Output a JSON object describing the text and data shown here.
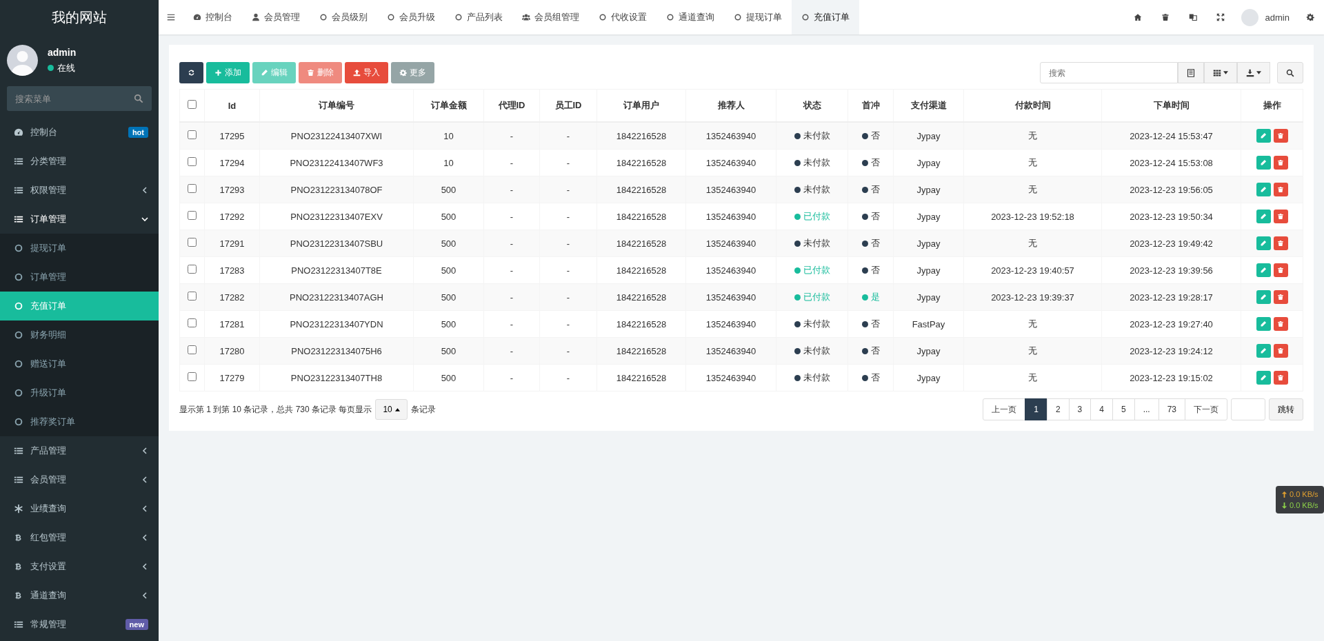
{
  "sidebar": {
    "title": "我的网站",
    "user": {
      "name": "admin",
      "status": "在线"
    },
    "search": {
      "placeholder": "搜索菜单"
    },
    "items": [
      {
        "label": "控制台",
        "kind": "dashboard",
        "badge": "hot",
        "color": "#0073b7"
      },
      {
        "label": "分类管理",
        "kind": "list"
      },
      {
        "label": "权限管理",
        "kind": "list",
        "expanded": false
      },
      {
        "label": "订单管理",
        "kind": "list",
        "expanded": true,
        "children": [
          {
            "label": "提现订单",
            "selected": false
          },
          {
            "label": "订单管理",
            "selected": false
          },
          {
            "label": "充值订单",
            "selected": true
          },
          {
            "label": "财务明细",
            "selected": false
          },
          {
            "label": "赠送订单",
            "selected": false
          },
          {
            "label": "升级订单",
            "selected": false
          },
          {
            "label": "推荐奖订单",
            "selected": false
          }
        ]
      },
      {
        "label": "产品管理",
        "kind": "list",
        "expanded": false
      },
      {
        "label": "会员管理",
        "kind": "list",
        "expanded": false
      },
      {
        "label": "业绩查询",
        "kind": "asterisk",
        "expanded": false
      },
      {
        "label": "红包管理",
        "kind": "bitcoin",
        "expanded": false
      },
      {
        "label": "支付设置",
        "kind": "bitcoin",
        "expanded": false
      },
      {
        "label": "通道查询",
        "kind": "bitcoin",
        "expanded": false
      },
      {
        "label": "常规管理",
        "kind": "list",
        "badge": "new",
        "color": "#605ca8"
      }
    ]
  },
  "topbar": {
    "tabs": [
      {
        "label": "控制台",
        "kind": "dashboard",
        "selected": false
      },
      {
        "label": "会员管理",
        "kind": "user",
        "selected": false
      },
      {
        "label": "会员级别",
        "kind": "circle",
        "selected": false
      },
      {
        "label": "会员升级",
        "kind": "circle",
        "selected": false
      },
      {
        "label": "产品列表",
        "kind": "circle",
        "selected": false
      },
      {
        "label": "会员组管理",
        "kind": "users",
        "selected": false
      },
      {
        "label": "代收设置",
        "kind": "circle",
        "selected": false
      },
      {
        "label": "通道查询",
        "kind": "circle",
        "selected": false
      },
      {
        "label": "提现订单",
        "kind": "circle",
        "selected": false
      },
      {
        "label": "充值订单",
        "kind": "circle",
        "selected": true
      }
    ],
    "user": "admin"
  },
  "toolbar": {
    "buttons": [
      {
        "kind": "refresh",
        "disabled": false
      },
      {
        "kind": "add",
        "label": "添加",
        "disabled": false
      },
      {
        "kind": "edit",
        "label": "编辑",
        "disabled": true
      },
      {
        "kind": "delete",
        "label": "删除",
        "disabled": true
      },
      {
        "kind": "import",
        "label": "导入",
        "disabled": false
      },
      {
        "kind": "more",
        "label": "更多",
        "disabled": false
      }
    ],
    "search": {
      "placeholder": "搜索"
    }
  },
  "table": {
    "select_all_checked": false,
    "columns": [
      "Id",
      "订单编号",
      "订单金额",
      "代理ID",
      "员工ID",
      "订单用户",
      "推荐人",
      "状态",
      "首冲",
      "支付渠道",
      "付款时间",
      "下单时间",
      "操作"
    ],
    "rows": [
      {
        "checked": false,
        "id": "17295",
        "order_no": "PNO23122413407XWI",
        "amount": "10",
        "agent": "-",
        "staff": "-",
        "user": "1842216528",
        "referrer": "1352463940",
        "status": {
          "label": "未付款",
          "color": "#2c3e50"
        },
        "first": {
          "label": "否",
          "color": "#2c3e50"
        },
        "channel": "Jypay",
        "paid_at": "无",
        "created_at": "2023-12-24 15:53:47"
      },
      {
        "checked": false,
        "id": "17294",
        "order_no": "PNO23122413407WF3",
        "amount": "10",
        "agent": "-",
        "staff": "-",
        "user": "1842216528",
        "referrer": "1352463940",
        "status": {
          "label": "未付款",
          "color": "#2c3e50"
        },
        "first": {
          "label": "否",
          "color": "#2c3e50"
        },
        "channel": "Jypay",
        "paid_at": "无",
        "created_at": "2023-12-24 15:53:08"
      },
      {
        "checked": false,
        "id": "17293",
        "order_no": "PNO231223134078OF",
        "amount": "500",
        "agent": "-",
        "staff": "-",
        "user": "1842216528",
        "referrer": "1352463940",
        "status": {
          "label": "未付款",
          "color": "#2c3e50"
        },
        "first": {
          "label": "否",
          "color": "#2c3e50"
        },
        "channel": "Jypay",
        "paid_at": "无",
        "created_at": "2023-12-23 19:56:05"
      },
      {
        "checked": false,
        "id": "17292",
        "order_no": "PNO23122313407EXV",
        "amount": "500",
        "agent": "-",
        "staff": "-",
        "user": "1842216528",
        "referrer": "1352463940",
        "status": {
          "label": "已付款",
          "color": "#18bc9c"
        },
        "first": {
          "label": "否",
          "color": "#2c3e50"
        },
        "channel": "Jypay",
        "paid_at": "2023-12-23 19:52:18",
        "created_at": "2023-12-23 19:50:34"
      },
      {
        "checked": false,
        "id": "17291",
        "order_no": "PNO23122313407SBU",
        "amount": "500",
        "agent": "-",
        "staff": "-",
        "user": "1842216528",
        "referrer": "1352463940",
        "status": {
          "label": "未付款",
          "color": "#2c3e50"
        },
        "first": {
          "label": "否",
          "color": "#2c3e50"
        },
        "channel": "Jypay",
        "paid_at": "无",
        "created_at": "2023-12-23 19:49:42"
      },
      {
        "checked": false,
        "id": "17283",
        "order_no": "PNO23122313407T8E",
        "amount": "500",
        "agent": "-",
        "staff": "-",
        "user": "1842216528",
        "referrer": "1352463940",
        "status": {
          "label": "已付款",
          "color": "#18bc9c"
        },
        "first": {
          "label": "否",
          "color": "#2c3e50"
        },
        "channel": "Jypay",
        "paid_at": "2023-12-23 19:40:57",
        "created_at": "2023-12-23 19:39:56"
      },
      {
        "checked": false,
        "id": "17282",
        "order_no": "PNO23122313407AGH",
        "amount": "500",
        "agent": "-",
        "staff": "-",
        "user": "1842216528",
        "referrer": "1352463940",
        "status": {
          "label": "已付款",
          "color": "#18bc9c"
        },
        "first": {
          "label": "是",
          "color": "#18bc9c"
        },
        "channel": "Jypay",
        "paid_at": "2023-12-23 19:39:37",
        "created_at": "2023-12-23 19:28:17"
      },
      {
        "checked": false,
        "id": "17281",
        "order_no": "PNO23122313407YDN",
        "amount": "500",
        "agent": "-",
        "staff": "-",
        "user": "1842216528",
        "referrer": "1352463940",
        "status": {
          "label": "未付款",
          "color": "#2c3e50"
        },
        "first": {
          "label": "否",
          "color": "#2c3e50"
        },
        "channel": "FastPay",
        "paid_at": "无",
        "created_at": "2023-12-23 19:27:40"
      },
      {
        "checked": false,
        "id": "17280",
        "order_no": "PNO231223134075H6",
        "amount": "500",
        "agent": "-",
        "staff": "-",
        "user": "1842216528",
        "referrer": "1352463940",
        "status": {
          "label": "未付款",
          "color": "#2c3e50"
        },
        "first": {
          "label": "否",
          "color": "#2c3e50"
        },
        "channel": "Jypay",
        "paid_at": "无",
        "created_at": "2023-12-23 19:24:12"
      },
      {
        "checked": false,
        "id": "17279",
        "order_no": "PNO23122313407TH8",
        "amount": "500",
        "agent": "-",
        "staff": "-",
        "user": "1842216528",
        "referrer": "1352463940",
        "status": {
          "label": "未付款",
          "color": "#2c3e50"
        },
        "first": {
          "label": "否",
          "color": "#2c3e50"
        },
        "channel": "Jypay",
        "paid_at": "无",
        "created_at": "2023-12-23 19:15:02"
      }
    ]
  },
  "pagination": {
    "summary": "显示第 1 到第 10 条记录，总共 730 条记录 每页显示",
    "page_size": "10",
    "suffix": "条记录",
    "prev": "上一页",
    "pages": [
      {
        "label": "1",
        "selected": true
      },
      {
        "label": "2",
        "selected": false
      },
      {
        "label": "3",
        "selected": false
      },
      {
        "label": "4",
        "selected": false
      },
      {
        "label": "5",
        "selected": false
      },
      {
        "label": "...",
        "selected": false
      },
      {
        "label": "73",
        "selected": false
      }
    ],
    "next": "下一页",
    "jump": "跳转"
  },
  "net_speed": {
    "up": "0.0 KB/s",
    "down": "0.0 KB/s"
  }
}
